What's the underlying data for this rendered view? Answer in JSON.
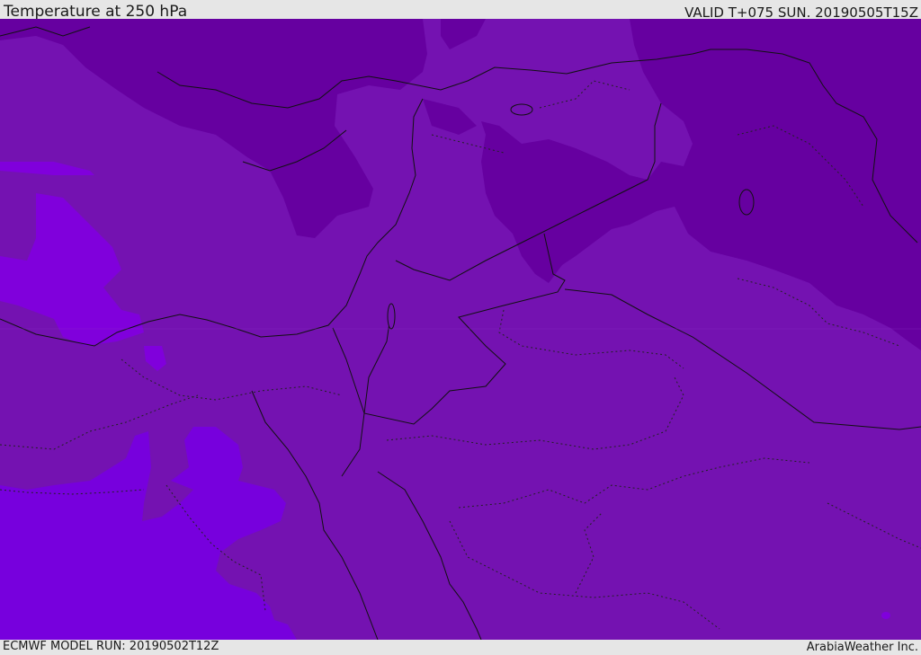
{
  "header": {
    "title": "Temperature at 250 hPa",
    "valid": "VALID T+075 SUN. 20190505T15Z"
  },
  "footer": {
    "model_run": "ECMWF MODEL RUN: 20190502T12Z",
    "credit": "ArabiaWeather Inc."
  },
  "colors": {
    "band_cold": "#6600a0",
    "band_mid": "#7412b1",
    "band_warm": "#8000dc",
    "band_warmest": "#7700dd",
    "border": "#111111",
    "background": "#e6e6e6"
  }
}
